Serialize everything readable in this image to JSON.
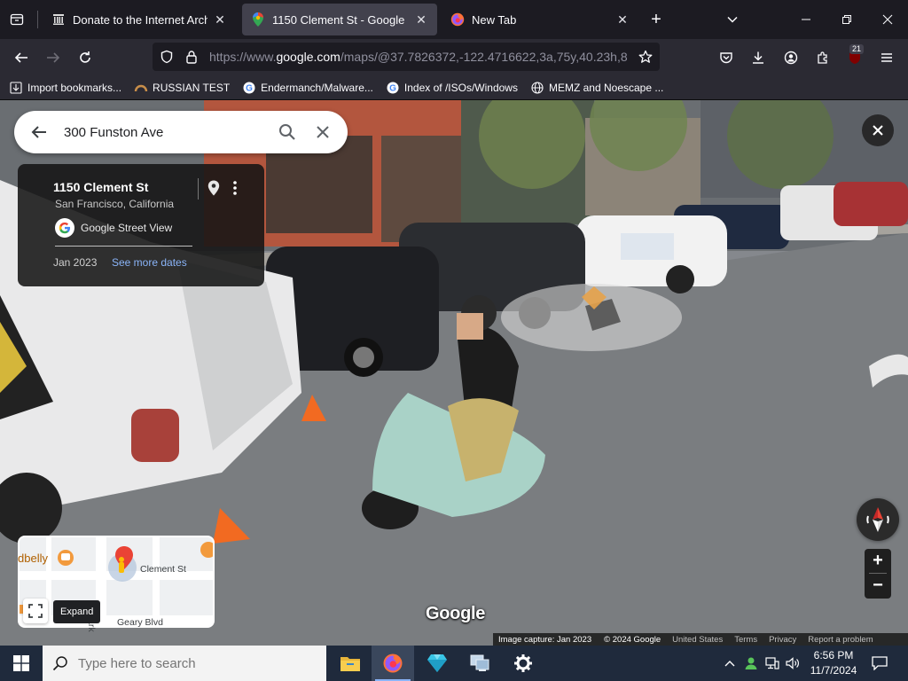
{
  "tabs": [
    {
      "label": "Donate to the Internet Archive!",
      "icon": "internet-archive-icon",
      "active": false
    },
    {
      "label": "1150 Clement St - Google Maps",
      "icon": "google-maps-icon",
      "active": true
    },
    {
      "label": "New Tab",
      "icon": "firefox-icon",
      "active": false
    }
  ],
  "toolbar": {
    "url_prefix": "https://www.",
    "url_host": "google.com",
    "url_path": "/maps/@37.7826372,-122.4716622,3a,75y,40.23h,8",
    "extension_badge": "21"
  },
  "bookmarks": [
    {
      "label": "Import bookmarks...",
      "icon": "import-icon"
    },
    {
      "label": "RUSSIAN TEST",
      "icon": "bookmark-site-icon"
    },
    {
      "label": "Endermanch/Malware...",
      "icon": "google-icon"
    },
    {
      "label": "Index of /ISOs/Windows",
      "icon": "google-icon"
    },
    {
      "label": "MEMZ and Noescape ...",
      "icon": "globe-icon"
    }
  ],
  "search": {
    "value": "300 Funston Ave"
  },
  "info_card": {
    "title": "1150 Clement St",
    "subtitle": "San Francisco, California",
    "provider": "Google Street View",
    "date": "Jan 2023",
    "more_dates": "See more dates"
  },
  "minimap": {
    "labels": [
      "dbelly",
      "Clement St",
      "Park",
      "Geary Blvd"
    ],
    "expand_tooltip": "Expand"
  },
  "watermark": "Google",
  "footer": {
    "capture": "Image capture: Jan 2023",
    "copyright": "© 2024 Google",
    "links": [
      "United States",
      "Terms",
      "Privacy",
      "Report a problem"
    ]
  },
  "taskbar": {
    "search_placeholder": "Type here to search",
    "time": "6:56 PM",
    "date": "11/7/2024"
  },
  "colors": {
    "firefox_tab_bg": "#1c1b22",
    "firefox_toolbar": "#2b2a33",
    "active_tab": "#42414d",
    "link_blue": "#8ab4f8",
    "taskbar": "#1f2a3c"
  }
}
